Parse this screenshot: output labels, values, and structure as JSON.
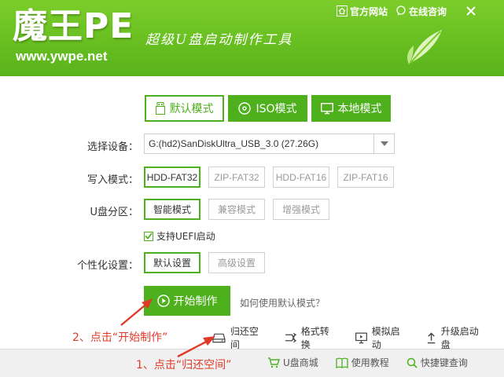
{
  "header": {
    "logo_text": "魔王PE",
    "logo_url": "www.ywpe.net",
    "slogan": "超级U盘启动制作工具",
    "links": [
      {
        "label": "官方网站",
        "icon": "home-icon"
      },
      {
        "label": "在线咨询",
        "icon": "chat-icon"
      }
    ],
    "close_icon": "close-icon",
    "leaf_icon": "leaf-icon",
    "accent_color": "#58b31a"
  },
  "tabs": [
    {
      "label": "默认模式",
      "icon": "usb-icon",
      "active": true
    },
    {
      "label": "ISO模式",
      "icon": "disc-icon",
      "active": false
    },
    {
      "label": "本地模式",
      "icon": "monitor-icon",
      "active": false
    }
  ],
  "device": {
    "label": "选择设备：",
    "value": "G:(hd2)SanDiskUltra_USB_3.0 (27.26G)"
  },
  "write_mode": {
    "label": "写入模式：",
    "options": [
      "HDD-FAT32",
      "ZIP-FAT32",
      "HDD-FAT16",
      "ZIP-FAT16"
    ],
    "selected": "HDD-FAT32"
  },
  "partition": {
    "label": "U盘分区：",
    "options": [
      "智能模式",
      "兼容模式",
      "增强模式"
    ],
    "selected": "智能模式"
  },
  "uefi": {
    "label": "支持UEFI启动",
    "checked": true
  },
  "personalize": {
    "label": "个性化设置：",
    "options": [
      "默认设置",
      "高级设置"
    ],
    "selected": "默认设置"
  },
  "start": {
    "label": "开始制作",
    "help_link": "如何使用默认模式？"
  },
  "tools": [
    {
      "label": "归还空间",
      "icon": "disk-icon"
    },
    {
      "label": "格式转换",
      "icon": "convert-icon"
    },
    {
      "label": "模拟启动",
      "icon": "monitor-play-icon"
    },
    {
      "label": "升级启动盘",
      "icon": "upload-icon"
    }
  ],
  "bottom_links": [
    {
      "label": "U盘商城",
      "icon": "cart-icon"
    },
    {
      "label": "使用教程",
      "icon": "book-icon"
    },
    {
      "label": "快捷键查询",
      "icon": "magnifier-icon"
    }
  ],
  "annotations": {
    "step1": "1、点击“归还空间”",
    "step2": "2、点击“开始制作”",
    "color": "#e03a2a"
  }
}
